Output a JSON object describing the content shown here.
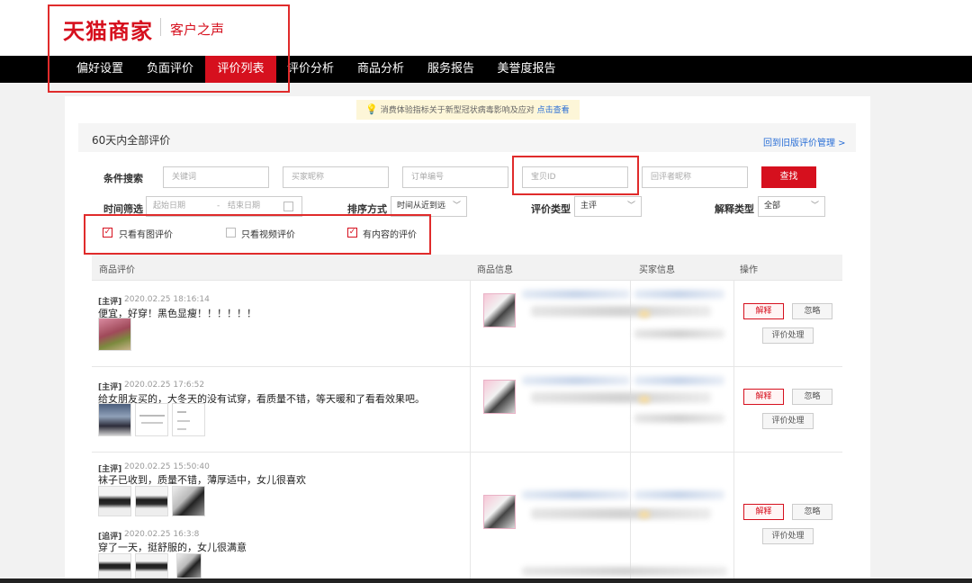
{
  "header": {
    "brand": "天猫商家",
    "subtitle": "客户之声"
  },
  "nav": {
    "items": [
      {
        "label": "偏好设置"
      },
      {
        "label": "负面评价"
      },
      {
        "label": "评价列表"
      },
      {
        "label": "评价分析"
      },
      {
        "label": "商品分析"
      },
      {
        "label": "服务报告"
      },
      {
        "label": "美誉度报告"
      }
    ],
    "active": "评价列表"
  },
  "notice": {
    "text": "消费体验指标关于新型冠状病毒影响及应对",
    "link": "点击查看"
  },
  "section": {
    "title": "60天内全部评价",
    "back_link": "回到旧版评价管理 >"
  },
  "filters": {
    "search_label": "条件搜索",
    "keyword_ph": "关键词",
    "buyer_ph": "买家昵称",
    "order_ph": "订单编号",
    "item_id_ph": "宝贝ID",
    "replier_ph": "回评者昵称",
    "search_btn": "查找",
    "time_label": "时间筛选",
    "start_ph": "起始日期",
    "date_sep": "-",
    "end_ph": "结束日期",
    "sort_label": "排序方式",
    "sort_value": "时间从近到远",
    "type_label": "评价类型",
    "type_value": "主评",
    "explain_label": "解释类型",
    "explain_value": "全部",
    "chk_image": "只看有图评价",
    "chk_video": "只看视频评价",
    "chk_content": "有内容的评价"
  },
  "table": {
    "headers": [
      "商品评价",
      "商品信息",
      "买家信息",
      "操作"
    ],
    "rows": [
      {
        "tag": "[主评]",
        "time": "2020.02.25 18:16:14",
        "text": "便宜，好穿！黑色显瘦！！！！！！"
      },
      {
        "tag": "[主评]",
        "time": "2020.02.25 17:6:52",
        "text": "给女朋友买的，大冬天的没有试穿，看质量不错，等天暖和了看看效果吧。"
      },
      {
        "tag": "[主评]",
        "time": "2020.02.25 15:50:40",
        "text": "袜子已收到，质量不错，薄厚适中，女儿很喜欢",
        "follow_tag": "[追评]",
        "follow_time": "2020.02.25 16:3:8",
        "follow_text": "穿了一天，挺舒服的，女儿很满意"
      }
    ],
    "actions": {
      "explain": "解释",
      "ignore": "忽略",
      "handle": "评价处理"
    }
  },
  "colors": {
    "brand": "#d6101e",
    "link": "#2a6fd6",
    "nav_bg": "#000000"
  }
}
